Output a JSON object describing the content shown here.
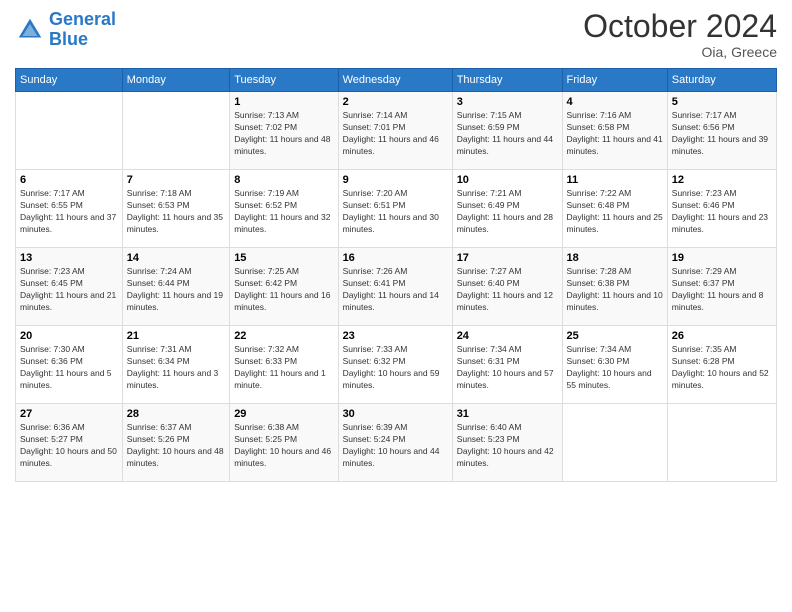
{
  "header": {
    "logo_line1": "General",
    "logo_line2": "Blue",
    "month": "October 2024",
    "location": "Oia, Greece"
  },
  "days_of_week": [
    "Sunday",
    "Monday",
    "Tuesday",
    "Wednesday",
    "Thursday",
    "Friday",
    "Saturday"
  ],
  "weeks": [
    [
      {
        "day": "",
        "sunrise": "",
        "sunset": "",
        "daylight": ""
      },
      {
        "day": "",
        "sunrise": "",
        "sunset": "",
        "daylight": ""
      },
      {
        "day": "1",
        "sunrise": "Sunrise: 7:13 AM",
        "sunset": "Sunset: 7:02 PM",
        "daylight": "Daylight: 11 hours and 48 minutes."
      },
      {
        "day": "2",
        "sunrise": "Sunrise: 7:14 AM",
        "sunset": "Sunset: 7:01 PM",
        "daylight": "Daylight: 11 hours and 46 minutes."
      },
      {
        "day": "3",
        "sunrise": "Sunrise: 7:15 AM",
        "sunset": "Sunset: 6:59 PM",
        "daylight": "Daylight: 11 hours and 44 minutes."
      },
      {
        "day": "4",
        "sunrise": "Sunrise: 7:16 AM",
        "sunset": "Sunset: 6:58 PM",
        "daylight": "Daylight: 11 hours and 41 minutes."
      },
      {
        "day": "5",
        "sunrise": "Sunrise: 7:17 AM",
        "sunset": "Sunset: 6:56 PM",
        "daylight": "Daylight: 11 hours and 39 minutes."
      }
    ],
    [
      {
        "day": "6",
        "sunrise": "Sunrise: 7:17 AM",
        "sunset": "Sunset: 6:55 PM",
        "daylight": "Daylight: 11 hours and 37 minutes."
      },
      {
        "day": "7",
        "sunrise": "Sunrise: 7:18 AM",
        "sunset": "Sunset: 6:53 PM",
        "daylight": "Daylight: 11 hours and 35 minutes."
      },
      {
        "day": "8",
        "sunrise": "Sunrise: 7:19 AM",
        "sunset": "Sunset: 6:52 PM",
        "daylight": "Daylight: 11 hours and 32 minutes."
      },
      {
        "day": "9",
        "sunrise": "Sunrise: 7:20 AM",
        "sunset": "Sunset: 6:51 PM",
        "daylight": "Daylight: 11 hours and 30 minutes."
      },
      {
        "day": "10",
        "sunrise": "Sunrise: 7:21 AM",
        "sunset": "Sunset: 6:49 PM",
        "daylight": "Daylight: 11 hours and 28 minutes."
      },
      {
        "day": "11",
        "sunrise": "Sunrise: 7:22 AM",
        "sunset": "Sunset: 6:48 PM",
        "daylight": "Daylight: 11 hours and 25 minutes."
      },
      {
        "day": "12",
        "sunrise": "Sunrise: 7:23 AM",
        "sunset": "Sunset: 6:46 PM",
        "daylight": "Daylight: 11 hours and 23 minutes."
      }
    ],
    [
      {
        "day": "13",
        "sunrise": "Sunrise: 7:23 AM",
        "sunset": "Sunset: 6:45 PM",
        "daylight": "Daylight: 11 hours and 21 minutes."
      },
      {
        "day": "14",
        "sunrise": "Sunrise: 7:24 AM",
        "sunset": "Sunset: 6:44 PM",
        "daylight": "Daylight: 11 hours and 19 minutes."
      },
      {
        "day": "15",
        "sunrise": "Sunrise: 7:25 AM",
        "sunset": "Sunset: 6:42 PM",
        "daylight": "Daylight: 11 hours and 16 minutes."
      },
      {
        "day": "16",
        "sunrise": "Sunrise: 7:26 AM",
        "sunset": "Sunset: 6:41 PM",
        "daylight": "Daylight: 11 hours and 14 minutes."
      },
      {
        "day": "17",
        "sunrise": "Sunrise: 7:27 AM",
        "sunset": "Sunset: 6:40 PM",
        "daylight": "Daylight: 11 hours and 12 minutes."
      },
      {
        "day": "18",
        "sunrise": "Sunrise: 7:28 AM",
        "sunset": "Sunset: 6:38 PM",
        "daylight": "Daylight: 11 hours and 10 minutes."
      },
      {
        "day": "19",
        "sunrise": "Sunrise: 7:29 AM",
        "sunset": "Sunset: 6:37 PM",
        "daylight": "Daylight: 11 hours and 8 minutes."
      }
    ],
    [
      {
        "day": "20",
        "sunrise": "Sunrise: 7:30 AM",
        "sunset": "Sunset: 6:36 PM",
        "daylight": "Daylight: 11 hours and 5 minutes."
      },
      {
        "day": "21",
        "sunrise": "Sunrise: 7:31 AM",
        "sunset": "Sunset: 6:34 PM",
        "daylight": "Daylight: 11 hours and 3 minutes."
      },
      {
        "day": "22",
        "sunrise": "Sunrise: 7:32 AM",
        "sunset": "Sunset: 6:33 PM",
        "daylight": "Daylight: 11 hours and 1 minute."
      },
      {
        "day": "23",
        "sunrise": "Sunrise: 7:33 AM",
        "sunset": "Sunset: 6:32 PM",
        "daylight": "Daylight: 10 hours and 59 minutes."
      },
      {
        "day": "24",
        "sunrise": "Sunrise: 7:34 AM",
        "sunset": "Sunset: 6:31 PM",
        "daylight": "Daylight: 10 hours and 57 minutes."
      },
      {
        "day": "25",
        "sunrise": "Sunrise: 7:34 AM",
        "sunset": "Sunset: 6:30 PM",
        "daylight": "Daylight: 10 hours and 55 minutes."
      },
      {
        "day": "26",
        "sunrise": "Sunrise: 7:35 AM",
        "sunset": "Sunset: 6:28 PM",
        "daylight": "Daylight: 10 hours and 52 minutes."
      }
    ],
    [
      {
        "day": "27",
        "sunrise": "Sunrise: 6:36 AM",
        "sunset": "Sunset: 5:27 PM",
        "daylight": "Daylight: 10 hours and 50 minutes."
      },
      {
        "day": "28",
        "sunrise": "Sunrise: 6:37 AM",
        "sunset": "Sunset: 5:26 PM",
        "daylight": "Daylight: 10 hours and 48 minutes."
      },
      {
        "day": "29",
        "sunrise": "Sunrise: 6:38 AM",
        "sunset": "Sunset: 5:25 PM",
        "daylight": "Daylight: 10 hours and 46 minutes."
      },
      {
        "day": "30",
        "sunrise": "Sunrise: 6:39 AM",
        "sunset": "Sunset: 5:24 PM",
        "daylight": "Daylight: 10 hours and 44 minutes."
      },
      {
        "day": "31",
        "sunrise": "Sunrise: 6:40 AM",
        "sunset": "Sunset: 5:23 PM",
        "daylight": "Daylight: 10 hours and 42 minutes."
      },
      {
        "day": "",
        "sunrise": "",
        "sunset": "",
        "daylight": ""
      },
      {
        "day": "",
        "sunrise": "",
        "sunset": "",
        "daylight": ""
      }
    ]
  ]
}
